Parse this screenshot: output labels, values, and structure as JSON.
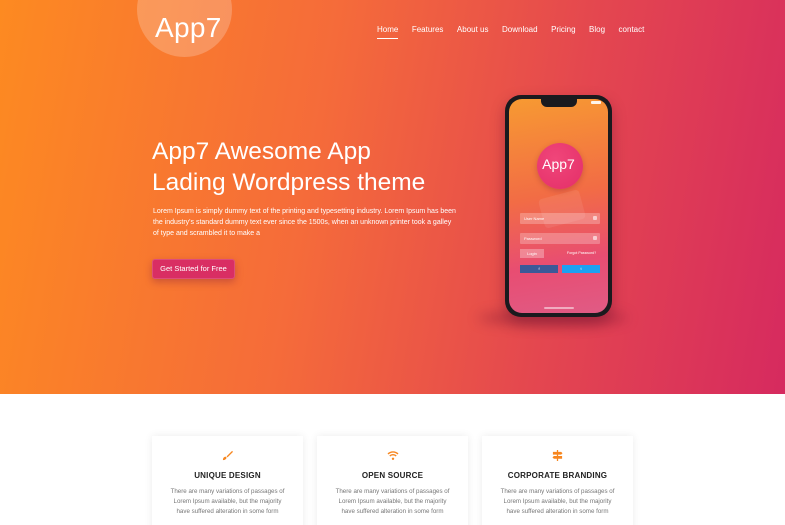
{
  "brand": {
    "name": "App7"
  },
  "nav": {
    "items": [
      {
        "label": "Home",
        "active": true
      },
      {
        "label": "Features"
      },
      {
        "label": "About us"
      },
      {
        "label": "Download"
      },
      {
        "label": "Pricing"
      },
      {
        "label": "Blog"
      },
      {
        "label": "contact"
      }
    ]
  },
  "hero": {
    "headline_line1": "App7 Awesome App",
    "headline_line2": "Lading Wordpress theme",
    "intro": "Lorem Ipsum is simply dummy text of the printing and typesetting industry. Lorem Ipsum has been the industry's standard dummy text ever since the 1500s, when an unknown printer took a galley of type and scrambled it to make a",
    "cta_label": "Get Started for Free"
  },
  "phone": {
    "app_name": "App7",
    "username_placeholder": "User Name",
    "password_placeholder": "Password",
    "login_label": "Login",
    "forgot_label": "Forgot Password?",
    "facebook_label": "f",
    "twitter_label": "t"
  },
  "features": [
    {
      "icon": "brush-icon",
      "title": "UNIQUE DESIGN",
      "desc": "There are many variations of passages of Lorem Ipsum available, but the majority have suffered alteration in some form"
    },
    {
      "icon": "wifi-icon",
      "title": "OPEN SOURCE",
      "desc": "There are many variations of passages of Lorem Ipsum available, but the majority have suffered alteration in some form"
    },
    {
      "icon": "signpost-icon",
      "title": "CORPORATE BRANDING",
      "desc": "There are many variations of passages of Lorem Ipsum available, but the majority have suffered alteration in some form"
    }
  ],
  "colors": {
    "gradient_start": "#fd8a21",
    "gradient_end": "#d62a5f",
    "cta": "#d92e63",
    "feature_icon": "#f7861f"
  }
}
